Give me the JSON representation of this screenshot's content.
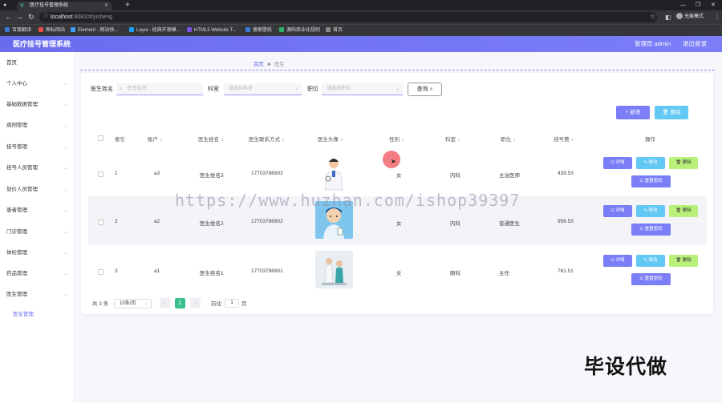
{
  "browser": {
    "tab_title": "医疗挂号管理系统",
    "url_host": "localhost",
    "url_rest": ":8081/#/yisheng",
    "profile_label": "无痕模式",
    "bookmarks": [
      {
        "label": "百度翻译",
        "color": "#3a7bd5"
      },
      {
        "label": "图标网站",
        "color": "#e94f4f"
      },
      {
        "label": "Element - 网站快...",
        "color": "#409eff"
      },
      {
        "label": "Layui - 经典开源模...",
        "color": "#1e9fff"
      },
      {
        "label": "HTML5 Website T...",
        "color": "#7b4fe0"
      },
      {
        "label": "搜索壁纸",
        "color": "#3a7bd5"
      },
      {
        "label": "源码商业化规则",
        "color": "#2fb36b"
      },
      {
        "label": "首页",
        "color": "#888888"
      }
    ]
  },
  "header": {
    "title": "医疗挂号管理系统",
    "admin": "管理员 admin",
    "logout": "退出登录"
  },
  "sidebar": {
    "items": [
      {
        "label": "首页",
        "has_children": false
      },
      {
        "label": "个人中心",
        "has_children": true
      },
      {
        "label": "基础数据管理",
        "has_children": true
      },
      {
        "label": "病例管理",
        "has_children": true
      },
      {
        "label": "挂号管理",
        "has_children": true
      },
      {
        "label": "挂号人员管理",
        "has_children": true
      },
      {
        "label": "划价人员管理",
        "has_children": true
      },
      {
        "label": "患者管理",
        "has_children": true
      },
      {
        "label": "门诊管理",
        "has_children": true
      },
      {
        "label": "体检管理",
        "has_children": true
      },
      {
        "label": "药品管理",
        "has_children": true
      },
      {
        "label": "医生管理",
        "has_children": true
      }
    ],
    "sub_item": "医生管理"
  },
  "breadcrumb": {
    "home": "首页",
    "current": "医生"
  },
  "search": {
    "name_label": "医生姓名",
    "name_placeholder": "医生姓名",
    "dept_label": "科室",
    "dept_placeholder": "请选择科室",
    "title_label": "职位",
    "title_placeholder": "请选择职位",
    "button": "查询"
  },
  "actions": {
    "add": "新增",
    "delete": "删除"
  },
  "table": {
    "headers": [
      "索引",
      "账户",
      "医生姓名",
      "医生联系方式",
      "医生头像",
      "性别",
      "科室",
      "职位",
      "挂号费",
      "操作"
    ],
    "rows": [
      {
        "index": "1",
        "account": "a3",
        "name": "医生姓名3",
        "phone": "17703786903",
        "gender": "女",
        "dept": "内科",
        "title": "主治医师",
        "fee": "439.53"
      },
      {
        "index": "2",
        "account": "a2",
        "name": "医生姓名2",
        "phone": "17703786902",
        "gender": "女",
        "dept": "内科",
        "title": "普通医生",
        "fee": "956.53"
      },
      {
        "index": "3",
        "account": "a1",
        "name": "医生姓名1",
        "phone": "17703786901",
        "gender": "女",
        "dept": "眼科",
        "title": "主任",
        "fee": "761.51"
      }
    ],
    "row_buttons": {
      "detail": "详情",
      "edit": "修改",
      "delete": "删除",
      "reset": "重置密码"
    }
  },
  "pagination": {
    "total": "共 3 条",
    "page_size": "10条/页",
    "current_page": "1",
    "goto_label": "前往",
    "goto_value": "1",
    "page_suffix": "页"
  },
  "overlay": {
    "watermark": "https://www.huzhan.com/ishop39397",
    "caption": "毕设代做"
  }
}
